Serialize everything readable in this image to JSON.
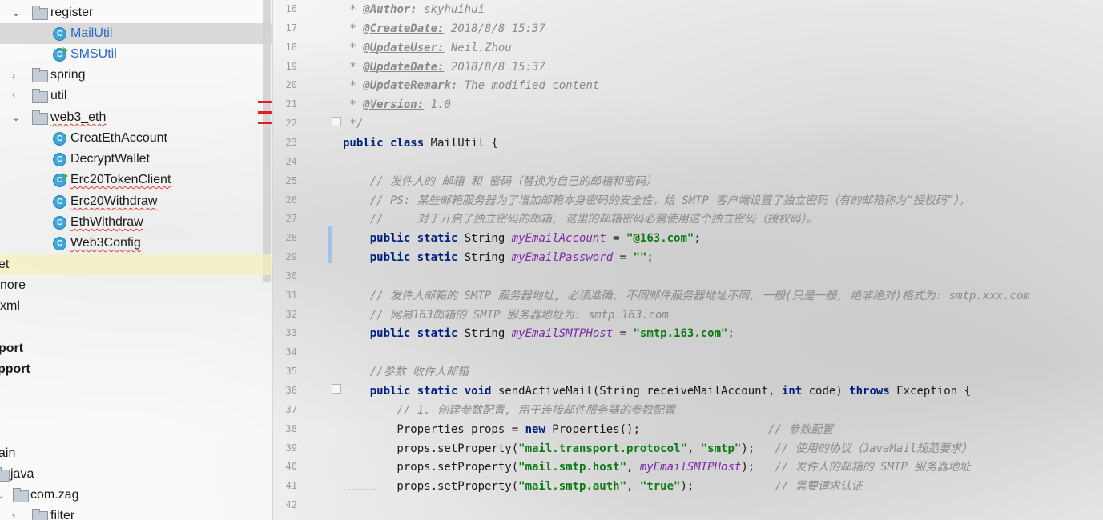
{
  "tree": {
    "items": [
      {
        "label": "register"
      },
      {
        "label": "MailUtil"
      },
      {
        "label": "SMSUtil"
      },
      {
        "label": "spring"
      },
      {
        "label": "util"
      },
      {
        "label": "web3_eth"
      },
      {
        "label": "CreatEthAccount"
      },
      {
        "label": "DecryptWallet"
      },
      {
        "label": "Erc20TokenClient"
      },
      {
        "label": "Erc20Withdraw"
      },
      {
        "label": "EthWithdraw"
      },
      {
        "label": "Web3Config"
      },
      {
        "label": "et"
      },
      {
        "label": "nore"
      },
      {
        "label": "xml"
      },
      {
        "label": "port"
      },
      {
        "label": "pport"
      },
      {
        "label": "ain"
      },
      {
        "label": "java"
      },
      {
        "label": "com.zag"
      },
      {
        "label": "filter"
      }
    ],
    "class_icon_glyph": "C"
  },
  "editor": {
    "lines": [
      {
        "no": "16",
        "c0": " * ",
        "tag": "@Author:",
        "c1": " skyhuihui"
      },
      {
        "no": "17",
        "c0": " * ",
        "tag": "@CreateDate:",
        "c1": " 2018/8/8 15:37"
      },
      {
        "no": "18",
        "c0": " * ",
        "tag": "@UpdateUser:",
        "c1": " Neil.Zhou"
      },
      {
        "no": "19",
        "c0": " * ",
        "tag": "@UpdateDate:",
        "c1": " 2018/8/8 15:37"
      },
      {
        "no": "20",
        "c0": " * ",
        "tag": "@UpdateRemark:",
        "c1": " The modified content"
      },
      {
        "no": "21",
        "c0": " * ",
        "tag": "@Version:",
        "c1": " 1.0"
      },
      {
        "no": "22",
        "c0": " */"
      },
      {
        "no": "23",
        "k0": "public class ",
        "t0": "MailUtil {"
      },
      {
        "no": "24"
      },
      {
        "no": "25",
        "c0": "    // 发件人的 邮箱 和 密码（替换为自己的邮箱和密码）"
      },
      {
        "no": "26",
        "c0": "    // PS: 某些邮箱服务器为了增加邮箱本身密码的安全性，给 SMTP 客户端设置了独立密码（有的邮箱称为“授权码”），"
      },
      {
        "no": "27",
        "c0": "    //     对于开启了独立密码的邮箱, 这里的邮箱密码必需使用这个独立密码（授权码）。"
      },
      {
        "no": "28",
        "k0": "    public static ",
        "t0": "String ",
        "f0": "myEmailAccount",
        "t1": " = ",
        "s0": "\"@163.com\"",
        "t2": ";"
      },
      {
        "no": "29",
        "k0": "    public static ",
        "t0": "String ",
        "f0": "myEmailPassword",
        "t1": " = ",
        "s0": "\"\"",
        "t2": ";"
      },
      {
        "no": "30"
      },
      {
        "no": "31",
        "c0": "    // 发件人邮箱的 SMTP 服务器地址, 必须准确, 不同邮件服务器地址不同, 一般(只是一般, 绝非绝对)格式为: smtp.xxx.com"
      },
      {
        "no": "32",
        "c0": "    // 网易163邮箱的 SMTP 服务器地址为: smtp.163.com"
      },
      {
        "no": "33",
        "k0": "    public static ",
        "t0": "String ",
        "f0": "myEmailSMTPHost",
        "t1": " = ",
        "s0": "\"smtp.163.com\"",
        "t2": ";"
      },
      {
        "no": "34"
      },
      {
        "no": "35",
        "c0": "    //参数 收件人邮箱"
      },
      {
        "no": "36",
        "k0": "    public static void ",
        "t0": "sendActiveMail(String receiveMailAccount, ",
        "k1": "int ",
        "t1": "code) ",
        "k2": "throws ",
        "t2": "Exception {"
      },
      {
        "no": "37",
        "c0": "        // 1. 创建参数配置, 用于连接邮件服务器的参数配置"
      },
      {
        "no": "38",
        "t0": "        Properties props = ",
        "k0": "new ",
        "t1": "Properties();                   ",
        "c0": "// 参数配置"
      },
      {
        "no": "39",
        "t0": "        props.setProperty(",
        "s0": "\"mail.transport.protocol\"",
        "t1": ", ",
        "s1": "\"smtp\"",
        "t2": ");   ",
        "c0": "// 使用的协议（JavaMail规范要求）"
      },
      {
        "no": "40",
        "t0": "        props.setProperty(",
        "s0": "\"mail.smtp.host\"",
        "t1": ", ",
        "f0": "myEmailSMTPHost",
        "t2": ");   ",
        "c0": "// 发件人的邮箱的 SMTP 服务器地址"
      },
      {
        "no": "41",
        "t0": "        props.setProperty(",
        "s0": "\"mail.smtp.auth\"",
        "t1": ", ",
        "s1": "\"true\"",
        "t2": ");            ",
        "c0": "// 需要请求认证"
      },
      {
        "no": "42"
      }
    ]
  },
  "colors": {
    "keyword": "#00207f",
    "string": "#0b7a12",
    "comment": "#8a8a8a",
    "field": "#7b2aa8",
    "class_icon": "#3fa6d9",
    "error_mark": "#e02020",
    "selection": "#d2d2d2"
  }
}
